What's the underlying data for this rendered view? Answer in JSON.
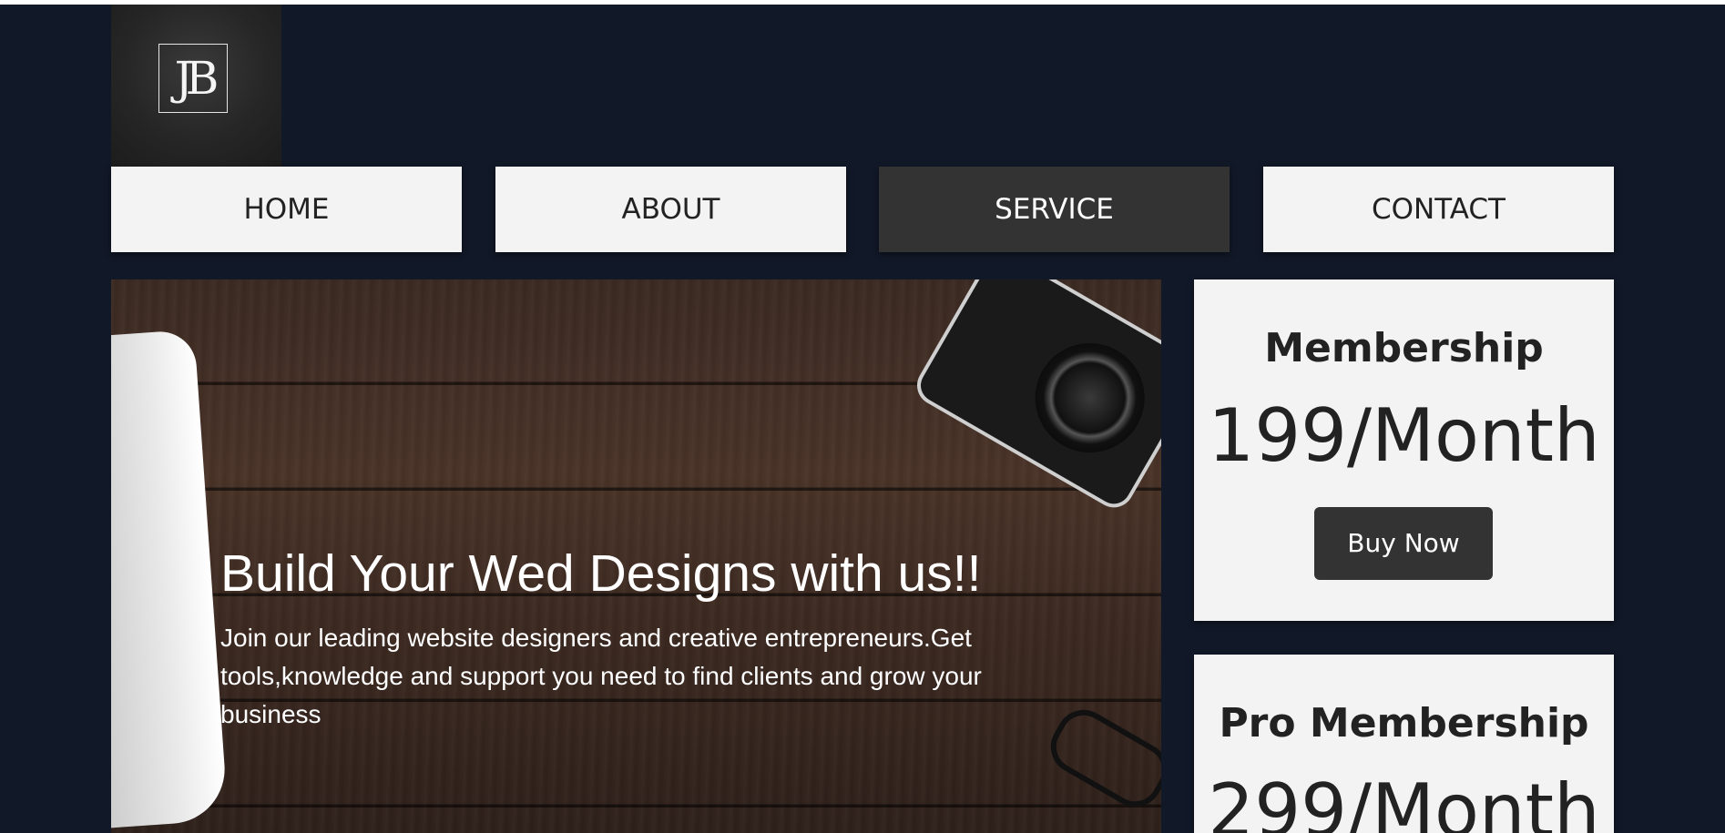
{
  "header": {
    "logo_text": "JB"
  },
  "nav": {
    "items": [
      {
        "label": "HOME",
        "active": false
      },
      {
        "label": "ABOUT",
        "active": false
      },
      {
        "label": "SERVICE",
        "active": true
      },
      {
        "label": "CONTACT",
        "active": false
      }
    ]
  },
  "hero": {
    "title": "Build Your Wed Designs with us!!",
    "description": "Join our leading website designers and creative entrepreneurs.Get tools,knowledge and support you need to find clients and grow your business"
  },
  "plans": [
    {
      "name": "Membership",
      "price": "199/Month",
      "button": "Buy Now"
    },
    {
      "name": "Pro Membership",
      "price": "299/Month"
    }
  ],
  "colors": {
    "background": "#111827",
    "nav_bg": "#f3f3f3",
    "nav_active_bg": "#333333",
    "button_bg": "#333333"
  }
}
